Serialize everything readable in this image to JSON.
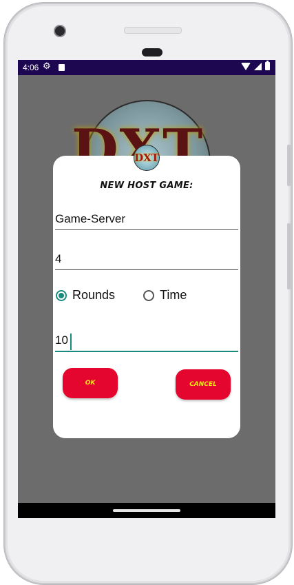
{
  "status_bar": {
    "time": "4:06",
    "icons": [
      "settings-gear-icon",
      "sd-card-icon",
      "wifi-icon",
      "signal-icon",
      "battery-icon"
    ]
  },
  "background": {
    "logo_text": "DXT"
  },
  "dialog": {
    "icon_text": "DXT",
    "title": "NEW HOST GAME:",
    "server_name": "Game-Server",
    "players": "4",
    "mode_options": [
      {
        "label": "Rounds",
        "checked": true
      },
      {
        "label": "Time",
        "checked": false
      }
    ],
    "count_value": "10",
    "ok_label": "OK",
    "cancel_label": "CANCEL"
  },
  "colors": {
    "status_bar": "#1d0750",
    "accent": "#1b8a7e",
    "button_bg": "#e4062e",
    "button_text": "#f5e21c",
    "overlay": "#6c6c6c"
  }
}
